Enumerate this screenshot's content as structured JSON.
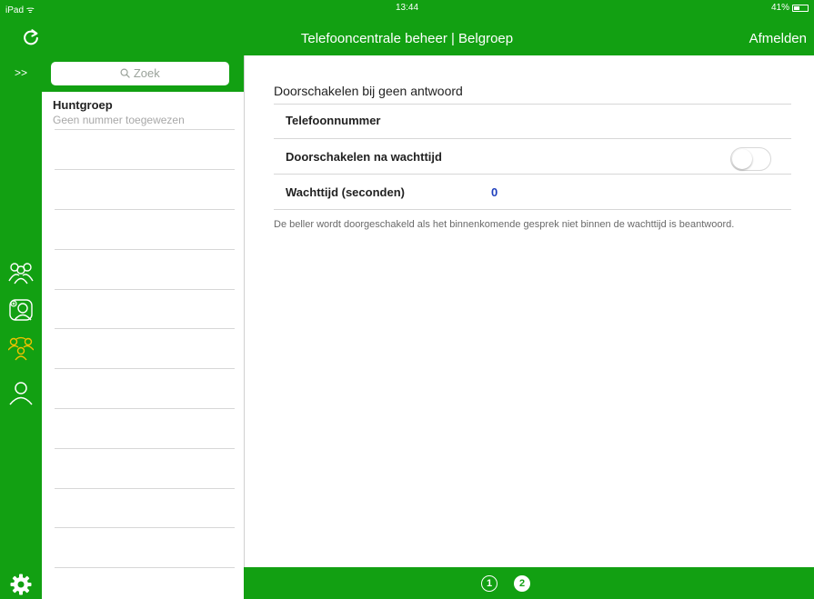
{
  "statusbar": {
    "device": "iPad ᯤ",
    "time": "13:44",
    "battery": "41%"
  },
  "navbar": {
    "title": "Telefooncentrale beheer | Belgroep",
    "logout_label": "Afmelden"
  },
  "rail": {
    "expand_label": ">>",
    "icons": [
      "group-users-icon",
      "add-user-icon",
      "huntgroup-icon",
      "user-icon"
    ],
    "active_color": "#f2c200"
  },
  "search": {
    "placeholder": "Zoek",
    "icon": "search-icon"
  },
  "list": {
    "items": [
      {
        "title": "Huntgroep",
        "subtitle": "Geen nummer toegewezen"
      }
    ]
  },
  "detail": {
    "section_title": "Doorschakelen bij geen antwoord",
    "rows": [
      {
        "label": "Telefoonnummer",
        "value": ""
      },
      {
        "label": "Doorschakelen na wachttijd",
        "toggle": false
      },
      {
        "label": "Wachttijd (seconden)",
        "value": "0"
      }
    ],
    "footnote": "De beller wordt doorgeschakeld als het binnenkomende gesprek niet binnen de wachttijd is beantwoord."
  },
  "pager": {
    "pages": [
      "1",
      "2"
    ],
    "current": "2"
  },
  "colors": {
    "brand_green": "#12a012",
    "value_blue": "#1f3fbd"
  }
}
